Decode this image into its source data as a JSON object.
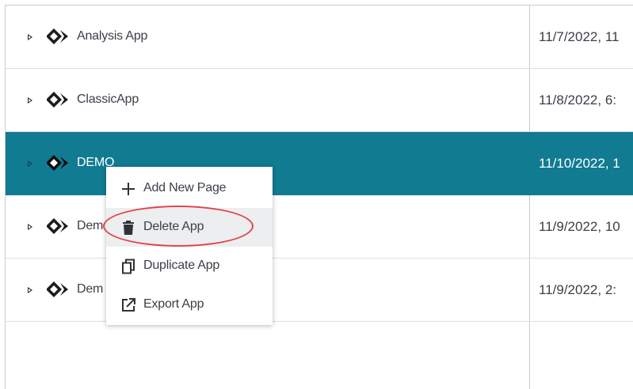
{
  "apps": [
    {
      "name": "Analysis App",
      "modified": "11/7/2022, 11",
      "selected": false
    },
    {
      "name": "ClassicApp",
      "modified": "11/8/2022, 6:",
      "selected": false
    },
    {
      "name": "DEMO",
      "modified": "11/10/2022, 1",
      "selected": true
    },
    {
      "name": "Dem",
      "modified": "11/9/2022, 10",
      "selected": false
    },
    {
      "name": "Dem",
      "modified": "11/9/2022, 2:",
      "selected": false
    }
  ],
  "context_menu": {
    "items": [
      {
        "label": "Add New Page",
        "icon": "plus-icon"
      },
      {
        "label": "Delete App",
        "icon": "trash-icon",
        "hovered": true
      },
      {
        "label": "Duplicate App",
        "icon": "duplicate-icon"
      },
      {
        "label": "Export App",
        "icon": "export-icon"
      }
    ]
  },
  "colors": {
    "selected_row": "#117b92",
    "annotation_oval": "#e0454a"
  }
}
